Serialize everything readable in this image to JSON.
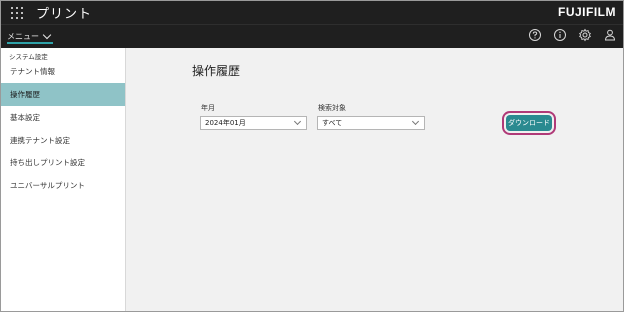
{
  "header": {
    "app_title": "プリント",
    "brand": "FUJIFILM"
  },
  "subbar": {
    "menu_label": "メニュー"
  },
  "top_icons": [
    "help-icon",
    "info-icon",
    "settings-icon",
    "user-icon"
  ],
  "sidebar": {
    "section_label": "システム設定",
    "items": [
      {
        "label": "テナント情報",
        "active": false
      },
      {
        "label": "操作履歴",
        "active": true
      },
      {
        "label": "基本設定",
        "active": false
      },
      {
        "label": "連携テナント設定",
        "active": false
      },
      {
        "label": "持ち出しプリント設定",
        "active": false
      },
      {
        "label": "ユニバーサルプリント",
        "active": false
      }
    ]
  },
  "main": {
    "title": "操作履歴",
    "year_month": {
      "label": "年月",
      "value": "2024年01月"
    },
    "search_target": {
      "label": "検索対象",
      "value": "すべて"
    },
    "download_label": "ダウンロード"
  },
  "colors": {
    "accent": "#2a8a90",
    "active_item": "#8fc3c7",
    "highlight": "#b03a78"
  }
}
